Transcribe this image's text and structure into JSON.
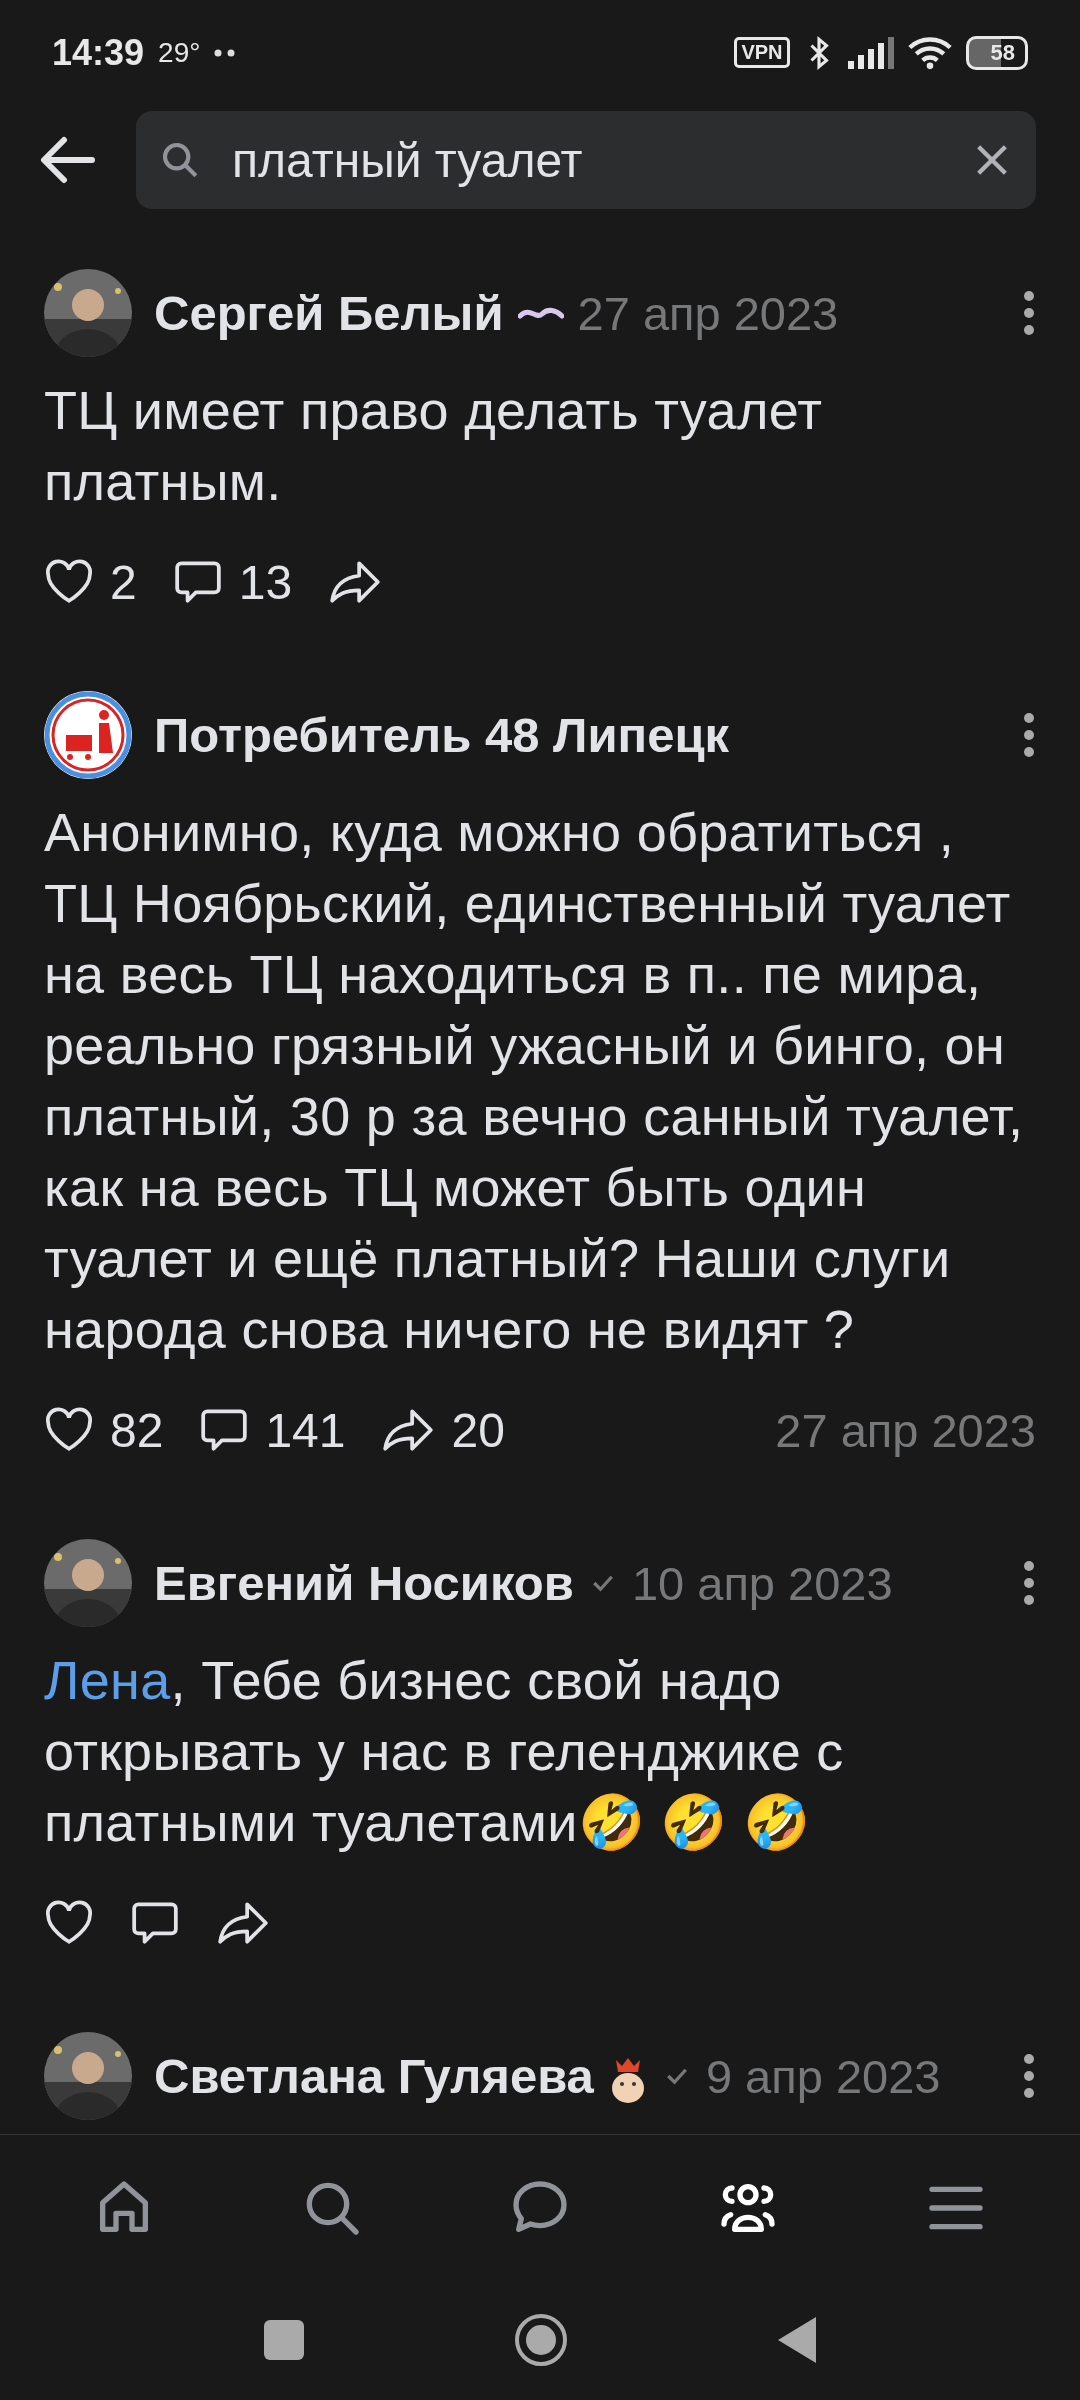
{
  "status_bar": {
    "time": "14:39",
    "temperature": "29°",
    "vpn": "VPN",
    "battery": "58"
  },
  "search": {
    "value": "платный туалет"
  },
  "posts": [
    {
      "author": "Сергей Белый",
      "ribbon": true,
      "verified": false,
      "sticker": false,
      "date": "27 апр 2023",
      "text": "ТЦ имеет право делать туалет платным.",
      "likes": "2",
      "comments": "13"
    },
    {
      "author": "Потребитель 48 Липецк",
      "ribbon": false,
      "verified": false,
      "sticker": false,
      "footer_date": "27 апр 2023",
      "text": "Анонимно, куда можно обратиться , ТЦ Ноябрьский, единственный туалет на весь ТЦ находиться в п.. пе мира, реально грязный ужасный и бинго, он платный, 30 р за вечно санный туалет, как на весь ТЦ может быть один туалет и ещё платный? Наши слуги народа снова ничего не видят ?",
      "likes": "82",
      "comments": "141",
      "shares": "20"
    },
    {
      "author": "Евгений Носиков",
      "ribbon": false,
      "verified": true,
      "sticker": false,
      "date": "10 апр 2023",
      "mention": "Лена",
      "text": ", Тебе бизнес свой надо открывать у нас в геленджике с платными туалетами🤣 🤣 🤣"
    },
    {
      "author": "Светлана Гуляева",
      "ribbon": false,
      "verified": true,
      "sticker": true,
      "date": "9 апр 2023"
    }
  ],
  "nav": [
    {
      "kind": "home",
      "selected": false
    },
    {
      "kind": "search",
      "selected": false
    },
    {
      "kind": "messages",
      "selected": false
    },
    {
      "kind": "communities",
      "selected": true
    },
    {
      "kind": "menu",
      "selected": false
    }
  ]
}
